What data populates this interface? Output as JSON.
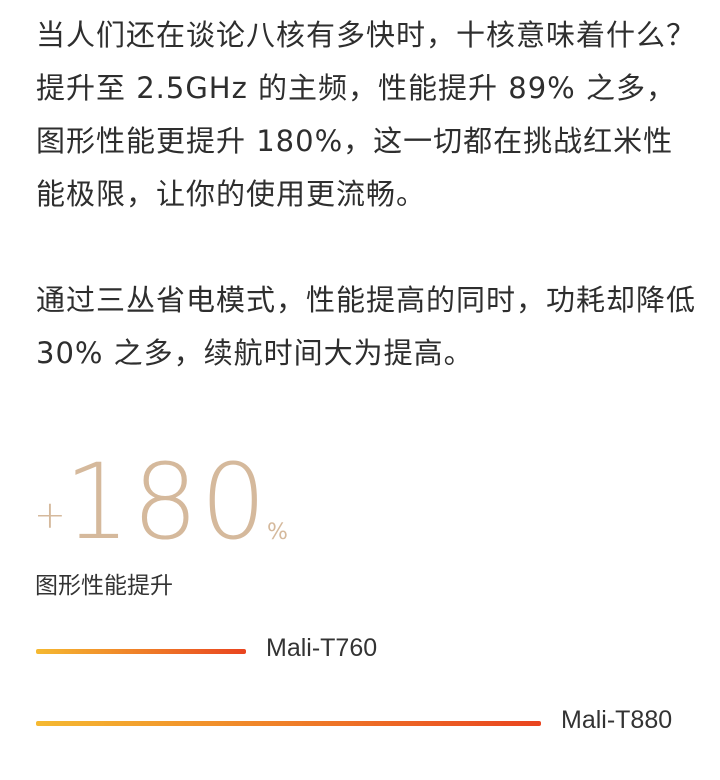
{
  "paragraphs": {
    "p1": "当人们还在谈论八核有多快时，十核意味着什么？提升至 2.5GHz 的主频，性能提升 89% 之多，图形性能更提升 180%，这一切都在挑战红米性能极限，让你的使用更流畅。",
    "p2": "通过三丛省电模式，性能提高的同时，功耗却降低 30% 之多，续航时间大为提高。"
  },
  "stat": {
    "plus": "+",
    "value": "180",
    "unit": "%",
    "label": "图形性能提升"
  },
  "comparison": {
    "items": [
      {
        "name": "Mali-T760",
        "relative_performance": 1.0
      },
      {
        "name": "Mali-T880",
        "relative_performance": 2.4
      }
    ],
    "gradient_start": "#f5b931",
    "gradient_end": "#e9441f"
  }
}
